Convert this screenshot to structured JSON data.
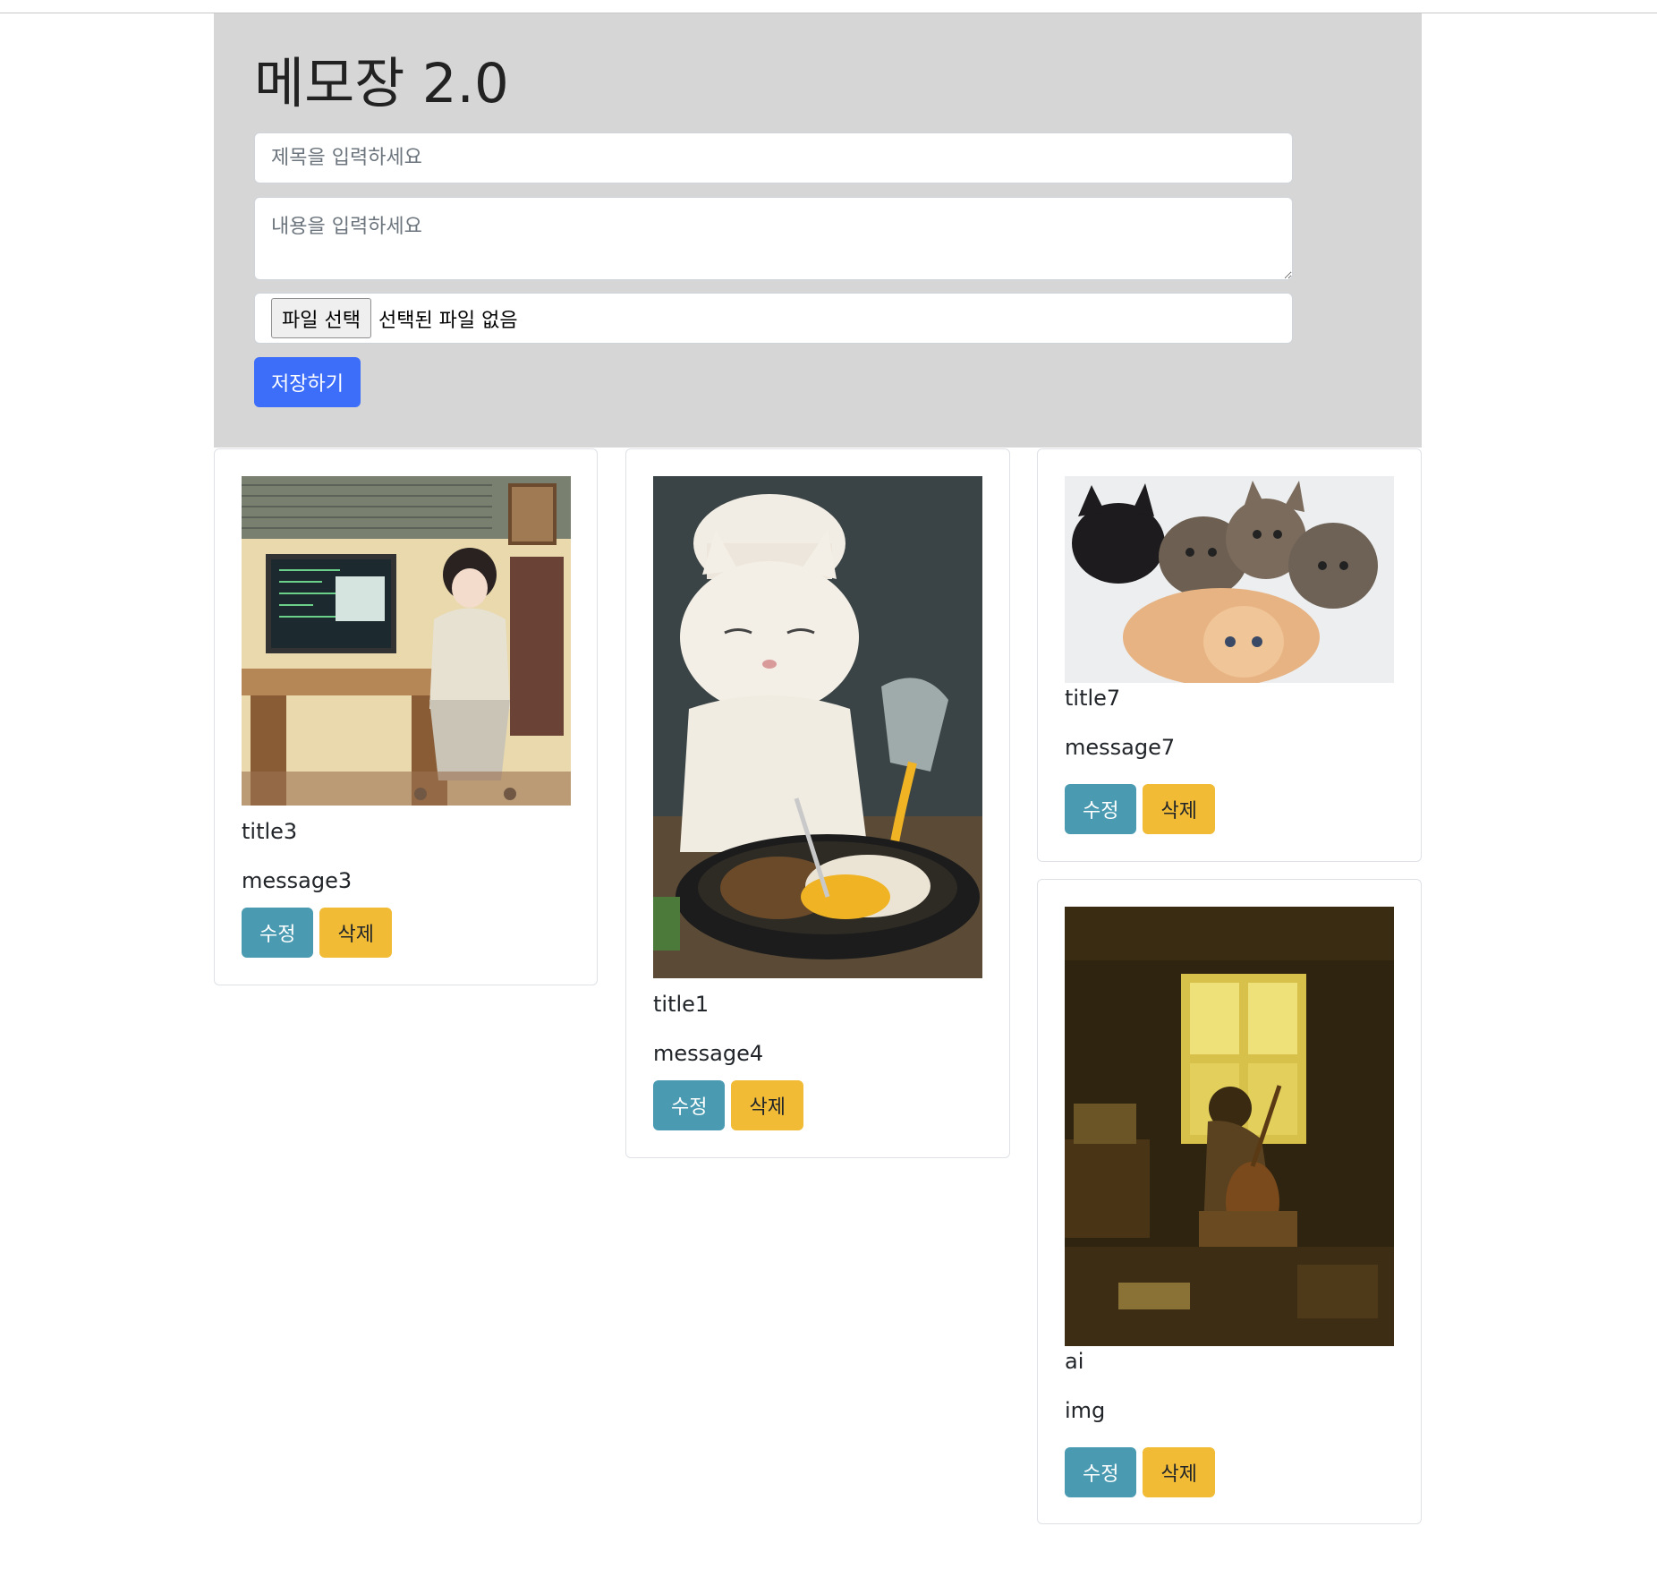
{
  "app": {
    "title": "메모장 2.0"
  },
  "form": {
    "title_placeholder": "제목을 입력하세요",
    "title_value": "",
    "content_placeholder": "내용을 입력하세요",
    "content_value": "",
    "file_button_label": "파일 선택",
    "file_status": "선택된 파일 없음",
    "save_label": "저장하기"
  },
  "colors": {
    "header_bg": "#d6d6d6",
    "primary": "#3d6ef9",
    "info": "#4a9bb2",
    "warning": "#f1bb35"
  },
  "cards": [
    {
      "title": "title3",
      "message": "message3",
      "image_icon": "coder-girl-illustration",
      "edit_label": "수정",
      "delete_label": "삭제"
    },
    {
      "title": "title1",
      "message": "message4",
      "image_icon": "chef-cat-cooking-photo",
      "edit_label": "수정",
      "delete_label": "삭제"
    },
    {
      "title": "title7",
      "message": "message7",
      "image_icon": "kittens-photo",
      "edit_label": "수정",
      "delete_label": "삭제"
    },
    {
      "title": "ai",
      "message": "img",
      "image_icon": "musician-room-illustration",
      "edit_label": "수정",
      "delete_label": "삭제"
    }
  ]
}
